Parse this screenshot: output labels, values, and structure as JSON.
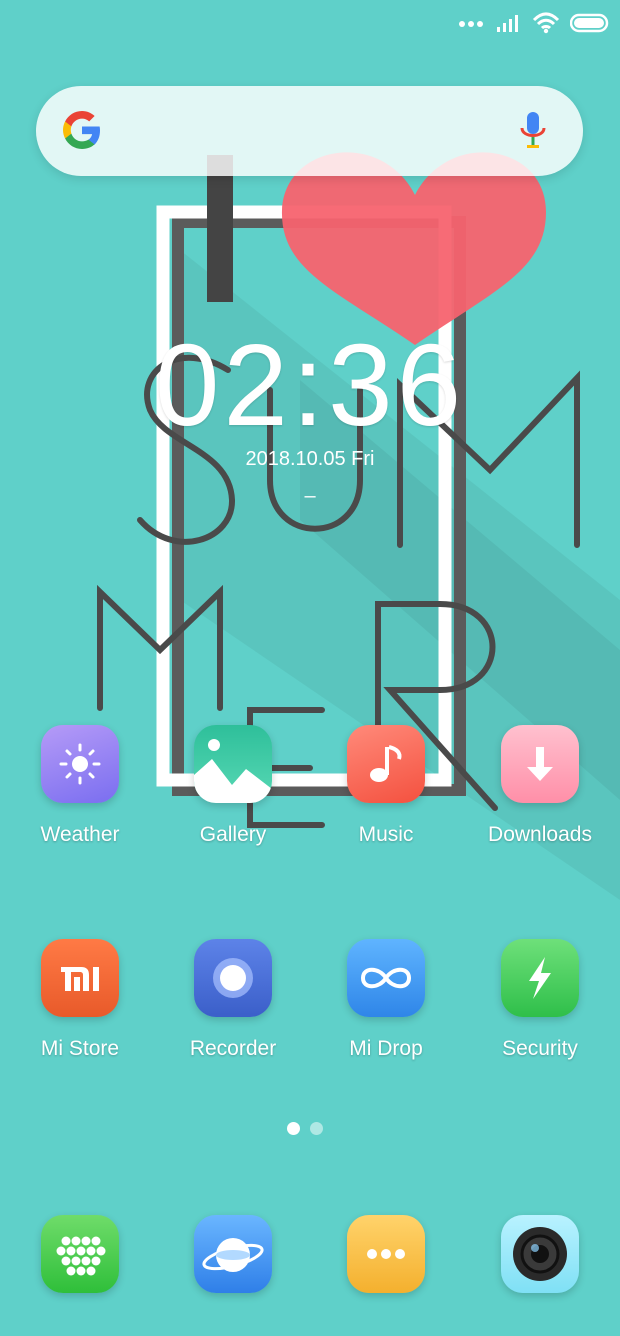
{
  "status_bar": {
    "icons": [
      "signal-dots-icon",
      "cellular-signal-icon",
      "wifi-icon",
      "battery-icon"
    ]
  },
  "search": {
    "logo": "google-logo-icon",
    "mic": "microphone-icon"
  },
  "clock": {
    "time": "02:36",
    "date": "2018.10.05 Fri",
    "sub": "–"
  },
  "apps_row1": [
    {
      "label": "Weather"
    },
    {
      "label": "Gallery"
    },
    {
      "label": "Music"
    },
    {
      "label": "Downloads"
    }
  ],
  "apps_row2": [
    {
      "label": "Mi Store"
    },
    {
      "label": "Recorder"
    },
    {
      "label": "Mi Drop"
    },
    {
      "label": "Security"
    }
  ],
  "dock": [
    "apps-grid-icon",
    "browser-icon",
    "more-icon",
    "camera-icon"
  ],
  "pager": {
    "pages": 2,
    "current": 1
  },
  "colors": {
    "background": "#5fd0c9",
    "heart": "#f7636f"
  }
}
